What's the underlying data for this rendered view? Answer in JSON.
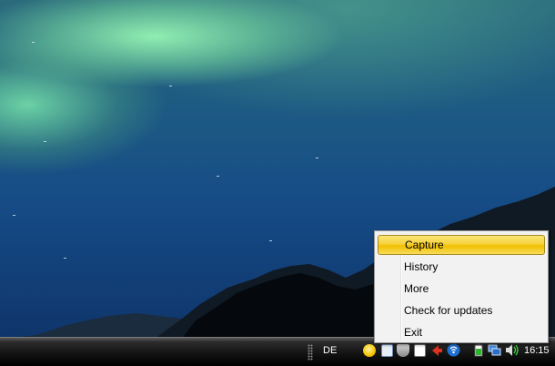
{
  "context_menu": {
    "items": [
      {
        "label": "Capture",
        "highlighted": true
      },
      {
        "label": "History",
        "highlighted": false
      },
      {
        "label": "More",
        "highlighted": false
      },
      {
        "label": "Check for updates",
        "highlighted": false
      },
      {
        "label": "Exit",
        "highlighted": false
      }
    ],
    "highlight_color": "#f6d23a"
  },
  "taskbar": {
    "language": "DE",
    "clock": "16:15",
    "tray_icons": [
      "capture-app-icon",
      "document-icon",
      "shield-icon",
      "network-activity-icon",
      "red-arrow-icon",
      "wireless-icon",
      "battery-icon",
      "network-icon",
      "volume-icon"
    ]
  }
}
